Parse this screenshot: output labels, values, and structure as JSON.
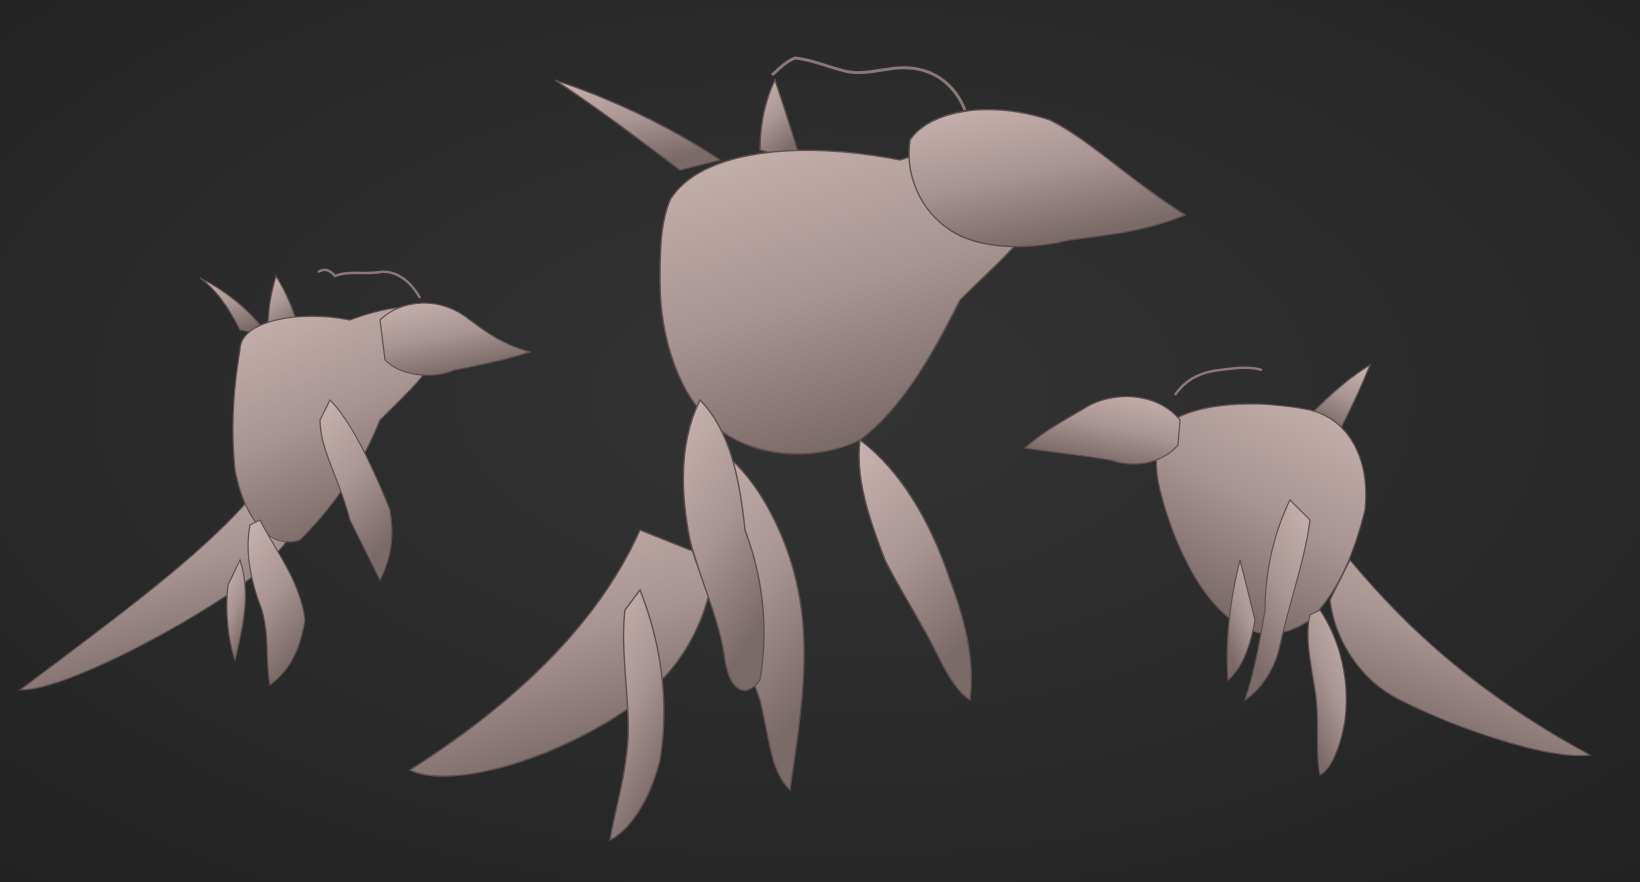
{
  "scene": {
    "background_color": "#2b2b2b",
    "background_highlight": "#333333",
    "model_color": "#b29c9a",
    "model_shadow": "#6e5e5d",
    "model_highlight": "#d8c6c3",
    "views": [
      {
        "name": "left-three-quarter-view"
      },
      {
        "name": "front-perspective-view"
      },
      {
        "name": "right-side-view"
      }
    ]
  }
}
